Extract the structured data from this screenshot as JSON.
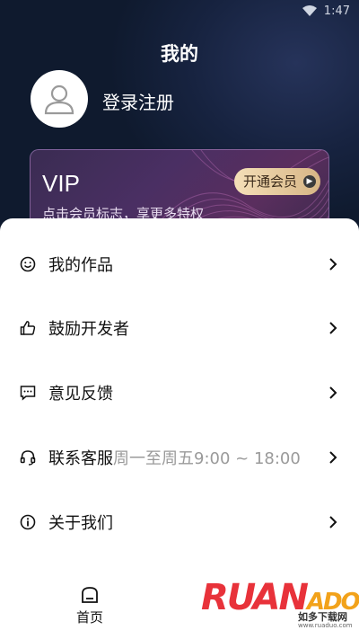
{
  "status_bar": {
    "time": "1:47"
  },
  "header": {
    "title": "我的"
  },
  "profile": {
    "login_label": "登录注册"
  },
  "vip": {
    "title": "VIP",
    "subtitle": "点击会员标志，享更多特权",
    "button_label": "开通会员"
  },
  "menu": [
    {
      "label": "我的作品",
      "extra": "",
      "icon": "smile-icon"
    },
    {
      "label": "鼓励开发者",
      "extra": "",
      "icon": "thumbs-up-icon"
    },
    {
      "label": "意见反馈",
      "extra": "",
      "icon": "feedback-icon"
    },
    {
      "label": "联系客服",
      "extra": "周一至周五9:00 ~ 18:00",
      "icon": "headset-icon"
    },
    {
      "label": "关于我们",
      "extra": "",
      "icon": "info-icon"
    }
  ],
  "tabbar": {
    "home_label": "首页"
  },
  "watermark": {
    "brand": "RUAN",
    "brand_ado": "ADO",
    "cn": "如多下载网",
    "url": "www.ruaduo.com"
  },
  "colors": {
    "background": "#0f1a2e",
    "vip_button": "#e9cf9f",
    "sheet": "#ffffff"
  }
}
